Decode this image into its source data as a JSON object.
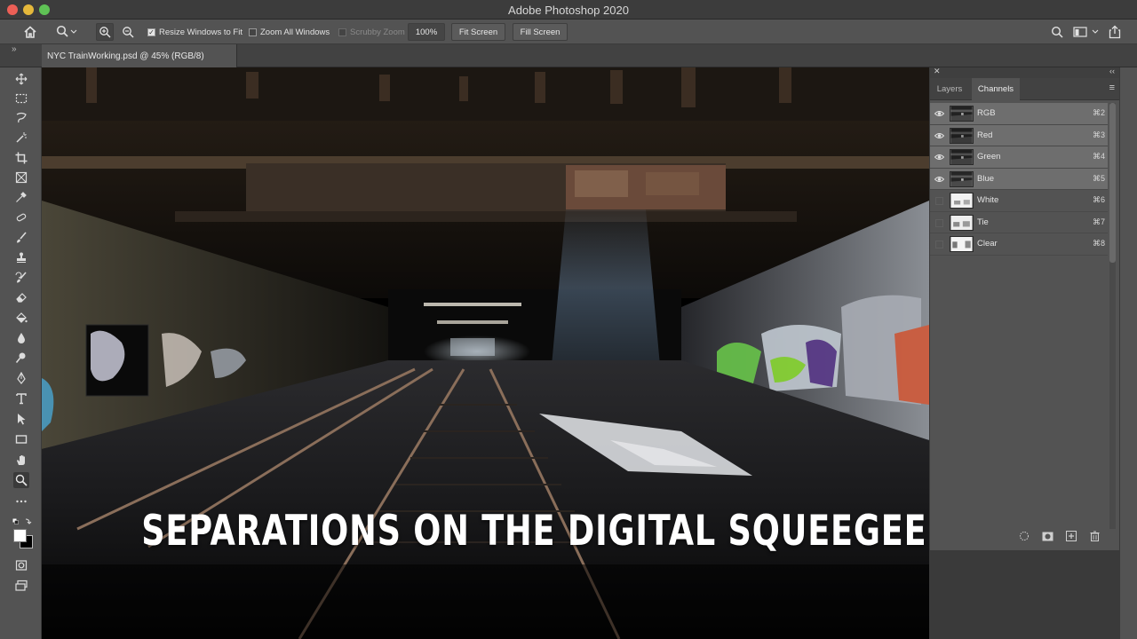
{
  "window": {
    "title": "Adobe Photoshop 2020"
  },
  "options_bar": {
    "resize_windows_label": "Resize Windows to Fit",
    "zoom_all_label": "Zoom All Windows",
    "scrubby_zoom_label": "Scrubby Zoom",
    "zoom_value": "100%",
    "fit_screen": "Fit Screen",
    "fill_screen": "Fill Screen"
  },
  "document_tab": {
    "title": "NYC TrainWorking.psd @ 45% (RGB/8)"
  },
  "caption": "SEPARATIONS ON THE DIGITAL SQUEEGEE",
  "panel": {
    "tabs": [
      "Layers",
      "Channels"
    ],
    "active_tab": "Channels",
    "channels": [
      {
        "name": "RGB",
        "shortcut": "⌘2",
        "visible": true
      },
      {
        "name": "Red",
        "shortcut": "⌘3",
        "visible": true
      },
      {
        "name": "Green",
        "shortcut": "⌘4",
        "visible": true
      },
      {
        "name": "Blue",
        "shortcut": "⌘5",
        "visible": true
      },
      {
        "name": "White",
        "shortcut": "⌘6",
        "visible": false
      },
      {
        "name": "Tie",
        "shortcut": "⌘7",
        "visible": false
      },
      {
        "name": "Clear",
        "shortcut": "⌘8",
        "visible": false
      }
    ]
  },
  "icons": {
    "home": "home-icon",
    "zoom": "zoom-tool-icon",
    "zoom_in": "zoom-in-icon",
    "zoom_out": "zoom-out-icon",
    "search": "search-icon",
    "workspace": "workspace-icon",
    "share": "share-icon"
  }
}
